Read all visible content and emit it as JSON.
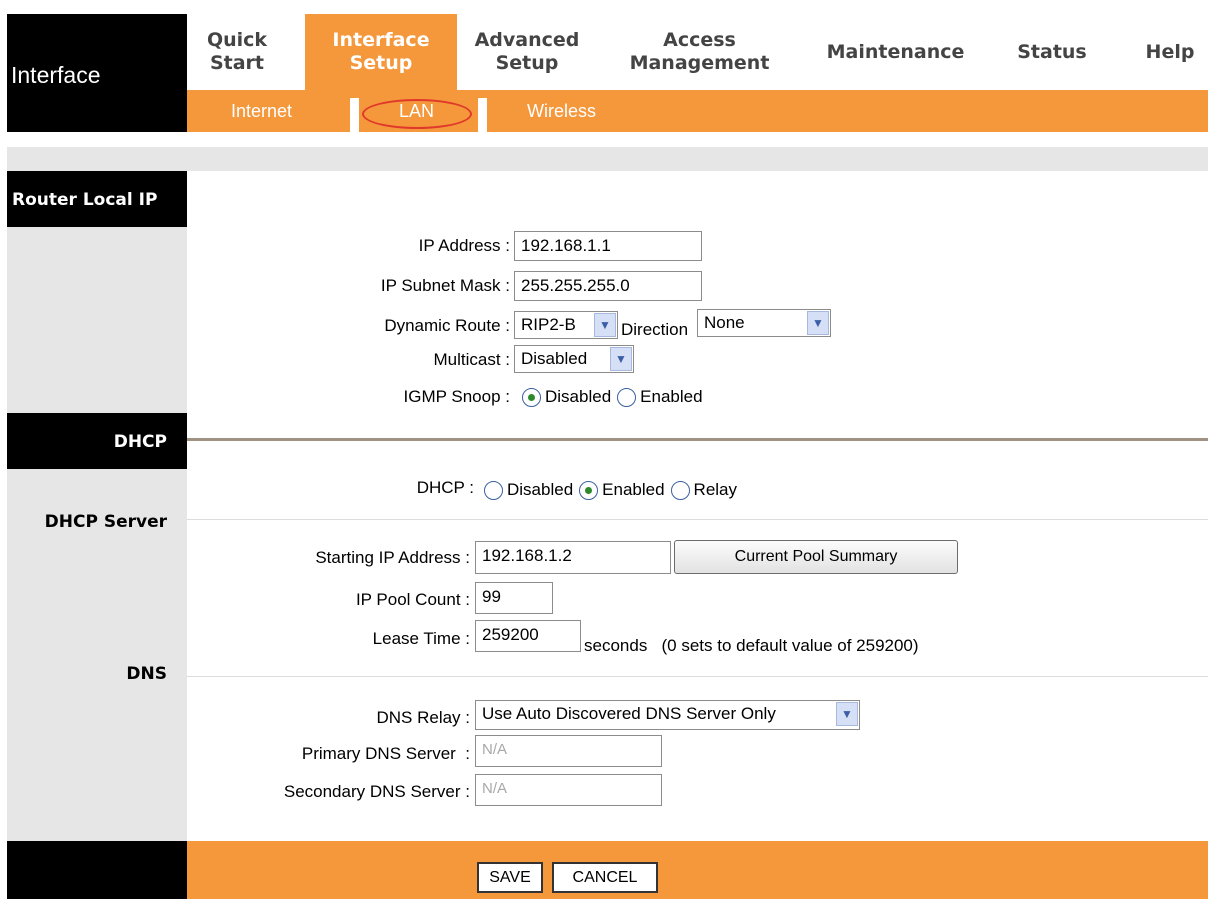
{
  "header": {
    "brand": "Interface",
    "tabs": [
      {
        "label": "Quick\nStart",
        "active": false
      },
      {
        "label": "Interface\nSetup",
        "active": true
      },
      {
        "label": "Advanced\nSetup",
        "active": false
      },
      {
        "label": "Access\nManagement",
        "active": false
      },
      {
        "label": "Maintenance",
        "active": false
      },
      {
        "label": "Status",
        "active": false
      },
      {
        "label": "Help",
        "active": false
      }
    ],
    "subtabs": [
      "Internet",
      "LAN",
      "Wireless"
    ],
    "selected_subtab": "LAN"
  },
  "sections": {
    "router_local_ip": "Router Local IP",
    "dhcp": "DHCP",
    "dhcp_server": "DHCP Server",
    "dns": "DNS"
  },
  "router": {
    "ip_label": "IP Address :",
    "ip_value": "192.168.1.1",
    "mask_label": "IP Subnet Mask :",
    "mask_value": "255.255.255.0",
    "route_label": "Dynamic Route :",
    "route_value": "RIP2-B",
    "direction_label": "Direction",
    "direction_value": "None",
    "multicast_label": "Multicast :",
    "multicast_value": "Disabled",
    "igmp_label": "IGMP Snoop :",
    "igmp_options": [
      "Disabled",
      "Enabled"
    ],
    "igmp_selected": "Disabled"
  },
  "dhcp": {
    "label": "DHCP :",
    "options": [
      "Disabled",
      "Enabled",
      "Relay"
    ],
    "selected": "Enabled",
    "start_label": "Starting IP Address :",
    "start_value": "192.168.1.2",
    "pool_button": "Current Pool Summary",
    "count_label": "IP Pool Count :",
    "count_value": "99",
    "lease_label": "Lease Time :",
    "lease_value": "259200",
    "lease_note": "seconds   (0 sets to default value of 259200)"
  },
  "dns": {
    "relay_label": "DNS Relay :",
    "relay_value": "Use Auto Discovered DNS Server Only",
    "primary_label": "Primary DNS Server  :",
    "primary_value": "N/A",
    "secondary_label": "Secondary DNS Server :",
    "secondary_value": "N/A"
  },
  "footer": {
    "save": "SAVE",
    "cancel": "CANCEL"
  },
  "colors": {
    "accent": "#f5973b",
    "panel": "#e6e6e6",
    "black": "#000000"
  }
}
